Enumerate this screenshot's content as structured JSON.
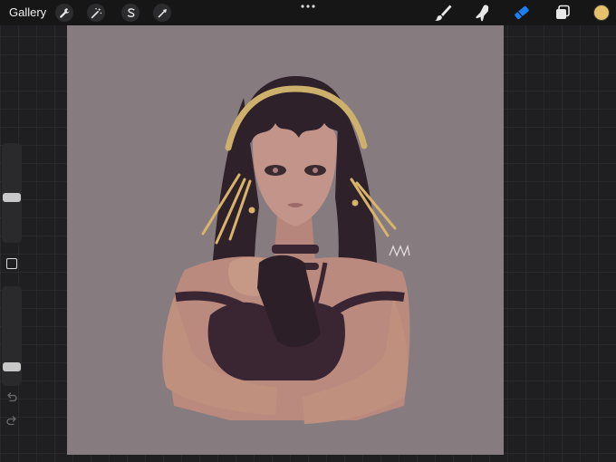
{
  "app": {
    "gallery_label": "Gallery"
  },
  "toolbar_left": [
    {
      "name": "actions-wrench",
      "icon": "wrench-icon"
    },
    {
      "name": "adjustments",
      "icon": "magic-wand-icon"
    },
    {
      "name": "selection",
      "icon": "selection-s-icon"
    },
    {
      "name": "transform",
      "icon": "arrow-cursor-icon"
    }
  ],
  "toolbar_right": [
    {
      "name": "brush",
      "icon": "brush-icon",
      "active": false
    },
    {
      "name": "smudge",
      "icon": "smudge-finger-icon",
      "active": false
    },
    {
      "name": "eraser",
      "icon": "eraser-icon",
      "active": true
    },
    {
      "name": "layers",
      "icon": "layers-icon",
      "active": false
    }
  ],
  "colors": {
    "active_tool": "#1e7ff5",
    "current_color": "#e7c06a",
    "canvas_background": "#867b7f"
  },
  "sidebar": {
    "brush_size_level": 0.45,
    "opacity_level": 0.15,
    "icons": [
      "modify-square-icon",
      "undo-arrow-icon",
      "redo-arrow-icon"
    ]
  }
}
